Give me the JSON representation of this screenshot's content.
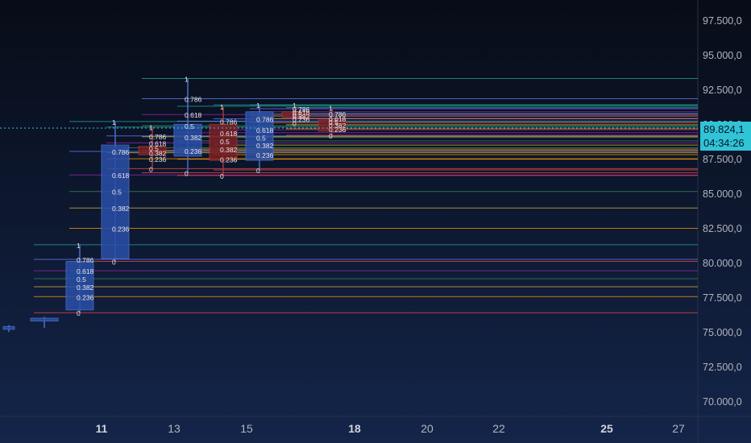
{
  "colors": {
    "background": "#0b1426",
    "bull_candle": "#2a4fa8",
    "bear_candle": "#7a1f24",
    "current_price_badge": "#2fc4d6"
  },
  "price_axis": {
    "labels": [
      "97.500,0",
      "95.000,0",
      "92.500,0",
      "90.000,0",
      "87.500,0",
      "85.000,0",
      "82.500,0",
      "80.000,0",
      "77.500,0",
      "75.000,0",
      "72.500,0",
      "70.000,0"
    ],
    "values": [
      97500,
      95000,
      92500,
      90000,
      87500,
      85000,
      82500,
      80000,
      77500,
      75000,
      72500,
      70000
    ]
  },
  "current_price": {
    "value": 89824.1,
    "label": "89.824,1",
    "countdown": "04:34:26"
  },
  "time_axis": {
    "labels": [
      "11",
      "13",
      "15",
      "18",
      "20",
      "22",
      "25",
      "27"
    ],
    "major": [
      "11",
      "18",
      "25"
    ]
  },
  "chart_data": {
    "type": "candlestick",
    "fib_levels": [
      "1",
      "0.786",
      "0.618",
      "0.5",
      "0.382",
      "0.236",
      "0"
    ],
    "candles": [
      {
        "open": 75300,
        "high": 75600,
        "low": 75100,
        "close": 75500
      },
      {
        "open": 75900,
        "high": 76200,
        "low": 75400,
        "close": 76100
      },
      {
        "open": 76700,
        "high": 81400,
        "low": 76500,
        "close": 80200
      },
      {
        "open": 80400,
        "high": 90300,
        "low": 80200,
        "close": 88600
      },
      {
        "open": 88500,
        "high": 89900,
        "low": 86900,
        "close": 87900
      },
      {
        "open": 87800,
        "high": 93400,
        "low": 86600,
        "close": 90100
      },
      {
        "open": 90100,
        "high": 91400,
        "low": 86400,
        "close": 87500
      },
      {
        "open": 87500,
        "high": 91500,
        "low": 86800,
        "close": 91000
      },
      {
        "open": 91000,
        "high": 91500,
        "low": 90200,
        "close": 90600
      },
      {
        "open": 90400,
        "high": 91300,
        "low": 89300,
        "close": 89600
      }
    ]
  }
}
